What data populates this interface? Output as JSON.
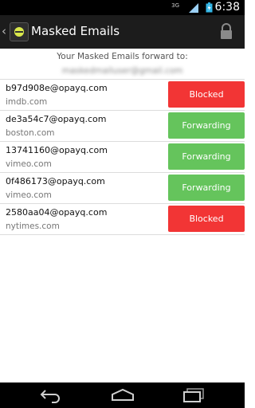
{
  "status_bar": {
    "network": "3G",
    "time": "6:38"
  },
  "action_bar": {
    "title": "Masked Emails"
  },
  "header": {
    "caption": "Your Masked Emails forward to:",
    "forward_address": "maskedmailuser@gmail.com"
  },
  "emails": [
    {
      "address": "b97d908e@opayq.com",
      "domain": "imdb.com",
      "status": "Blocked",
      "state": "blocked"
    },
    {
      "address": "de3a54c7@opayq.com",
      "domain": "boston.com",
      "status": "Forwarding",
      "state": "forwarding"
    },
    {
      "address": "13741160@opayq.com",
      "domain": "vimeo.com",
      "status": "Forwarding",
      "state": "forwarding"
    },
    {
      "address": "0f486173@opayq.com",
      "domain": "vimeo.com",
      "status": "Forwarding",
      "state": "forwarding"
    },
    {
      "address": "2580aa04@opayq.com",
      "domain": "nytimes.com",
      "status": "Blocked",
      "state": "blocked"
    }
  ],
  "colors": {
    "blocked": "#f23535",
    "forwarding": "#65c45c",
    "action_bar": "#1c1c1c"
  },
  "icons": {
    "back": "chevron-left-icon",
    "app": "app-logo-icon",
    "lock": "lock-icon",
    "nav_back": "back-arrow-icon",
    "nav_home": "home-icon",
    "nav_recents": "recent-apps-icon"
  }
}
